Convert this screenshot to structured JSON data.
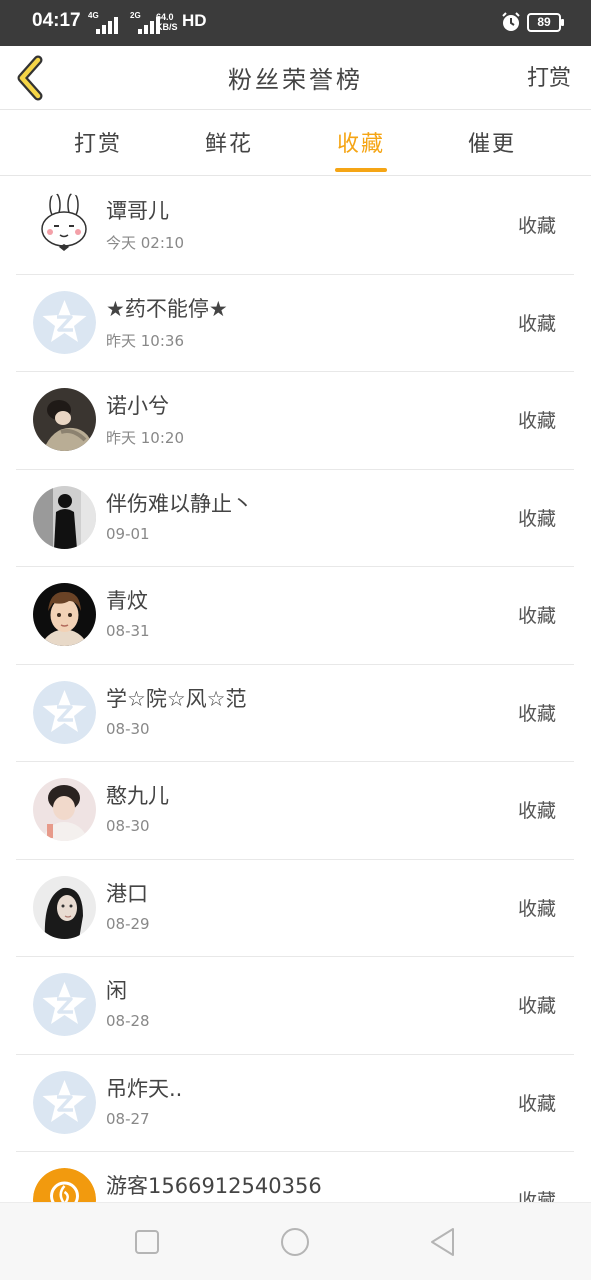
{
  "status_bar": {
    "time": "04:17",
    "signal1": "4G",
    "signal2": "2G",
    "net_speed_value": "64.0",
    "net_speed_unit": "KB/S",
    "hd": "HD",
    "battery": "89",
    "icons": [
      "signal-icon",
      "alarm-icon",
      "battery-icon"
    ]
  },
  "header": {
    "title": "粉丝荣誉榜",
    "right_action": "打赏",
    "back_icon": "chevron-left-icon",
    "accent_color": "#f5a515"
  },
  "tabs": [
    {
      "label": "打赏",
      "active": false
    },
    {
      "label": "鲜花",
      "active": false
    },
    {
      "label": "收藏",
      "active": true
    },
    {
      "label": "催更",
      "active": false
    }
  ],
  "fans": [
    {
      "name": "谭哥儿",
      "time": "今天 02:10",
      "action": "收藏",
      "avatar": "rabbit-avatar"
    },
    {
      "name": "★药不能停★",
      "time": "昨天 10:36",
      "action": "收藏",
      "avatar": "default-qq-avatar"
    },
    {
      "name": "诺小兮",
      "time": "昨天 10:20",
      "action": "收藏",
      "avatar": "photo-avatar"
    },
    {
      "name": "伴伤难以静止丶",
      "time": "09-01",
      "action": "收藏",
      "avatar": "silhouette-avatar"
    },
    {
      "name": "青炆",
      "time": "08-31",
      "action": "收藏",
      "avatar": "anime-boy-avatar"
    },
    {
      "name": "学☆院☆风☆范",
      "time": "08-30",
      "action": "收藏",
      "avatar": "default-qq-avatar"
    },
    {
      "name": "憨九儿",
      "time": "08-30",
      "action": "收藏",
      "avatar": "photo-avatar"
    },
    {
      "name": "港口",
      "time": "08-29",
      "action": "收藏",
      "avatar": "portrait-avatar"
    },
    {
      "name": "闲",
      "time": "08-28",
      "action": "收藏",
      "avatar": "default-qq-avatar"
    },
    {
      "name": "吊炸天..",
      "time": "08-27",
      "action": "收藏",
      "avatar": "default-qq-avatar"
    },
    {
      "name": "游客1566912540356",
      "time": "",
      "action": "收藏",
      "avatar": "orange-logo-avatar"
    }
  ],
  "nav_bar": {
    "icons": [
      "recent-apps-icon",
      "home-icon",
      "back-icon"
    ]
  }
}
